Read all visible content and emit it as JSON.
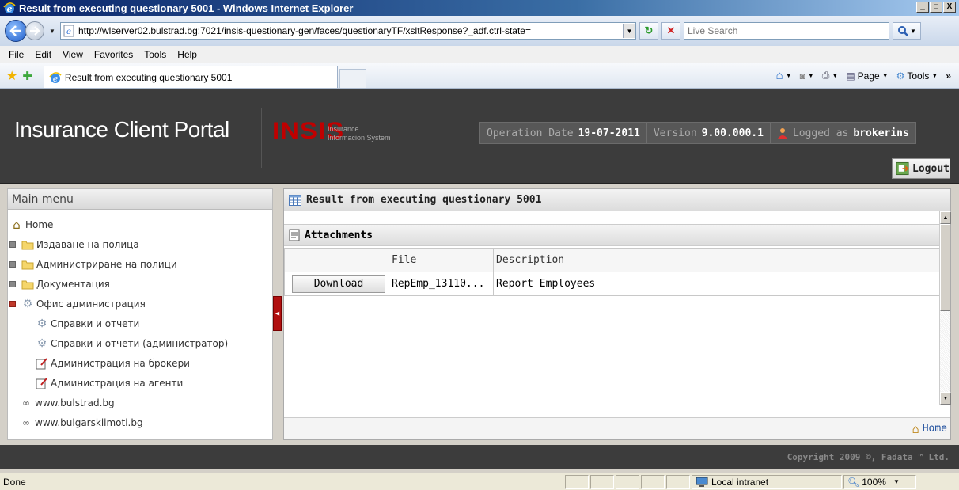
{
  "window": {
    "title": "Result from executing questionary 5001 - Windows Internet Explorer",
    "buttons": [
      "_",
      "□",
      "X"
    ]
  },
  "address_bar": {
    "url": "http://wlserver02.bulstrad.bg:7021/insis-questionary-gen/faces/questionaryTF/xsltResponse?_adf.ctrl-state=",
    "search_placeholder": "Live Search"
  },
  "menu_bar": {
    "items": [
      {
        "pre": "",
        "key": "F",
        "post": "ile"
      },
      {
        "pre": "",
        "key": "E",
        "post": "dit"
      },
      {
        "pre": "",
        "key": "V",
        "post": "iew"
      },
      {
        "pre": "F",
        "key": "a",
        "post": "vorites"
      },
      {
        "pre": "",
        "key": "T",
        "post": "ools"
      },
      {
        "pre": "",
        "key": "H",
        "post": "elp"
      }
    ]
  },
  "tab": {
    "title": "Result from executing questionary 5001"
  },
  "command_bar": {
    "page_label": "Page",
    "tools_label": "Tools"
  },
  "portal": {
    "title": "Insurance Client Portal",
    "logo": "INSIS",
    "logo_sub_1": "Insurance",
    "logo_sub_2": "Informacion System",
    "operation_date_label": "Operation Date",
    "operation_date": "19-07-2011",
    "version_label": "Version",
    "version": "9.00.000.1",
    "logged_label": "Logged as",
    "user": "brokerins",
    "logout_label": "Logout",
    "accent_color": "#c00000"
  },
  "main_menu": {
    "title": "Main menu",
    "items": [
      {
        "label": "Home",
        "icon": "home-icon"
      },
      {
        "label": "Издаване на полица",
        "icon": "folder-icon"
      },
      {
        "label": "Администриране на полици",
        "icon": "folder-icon"
      },
      {
        "label": "Документация",
        "icon": "folder-icon"
      },
      {
        "label": "Офис администрация",
        "icon": "gear-icon"
      },
      {
        "label": "Справки и отчети",
        "icon": "gear-icon"
      },
      {
        "label": "Справки и отчети (администратор)",
        "icon": "gear-icon"
      },
      {
        "label": "Администрация на брокери",
        "icon": "edit-icon"
      },
      {
        "label": "Администрация на агенти",
        "icon": "edit-icon"
      },
      {
        "label": "www.bulstrad.bg",
        "icon": "link-icon"
      },
      {
        "label": "www.bulgarskiimoti.bg",
        "icon": "link-icon"
      }
    ]
  },
  "content": {
    "panel_title": "Result from executing questionary 5001",
    "attachments_title": "Attachments",
    "table": {
      "headers": [
        "",
        "File",
        "Description"
      ],
      "rows": [
        {
          "action": "Download",
          "file": "RepEmp_13110...",
          "description": "Report Employees"
        }
      ]
    },
    "home_link": "Home"
  },
  "footer": {
    "copyright": "Copyright 2009 ©, Fadata ™ Ltd."
  },
  "status_bar": {
    "status": "Done",
    "zone": "Local intranet",
    "zoom": "100%"
  }
}
